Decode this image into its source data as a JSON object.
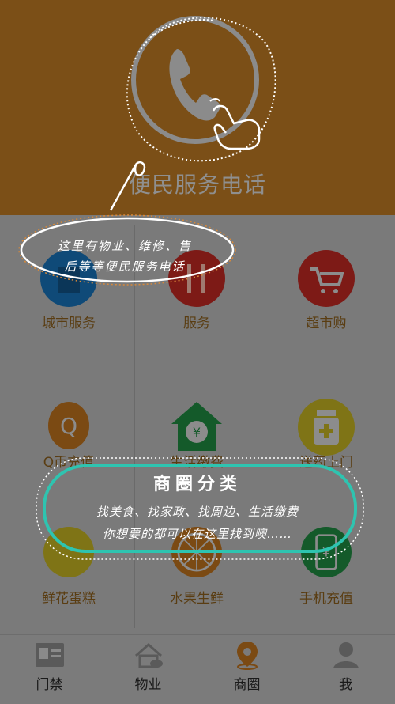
{
  "header": {
    "title": "便民服务电话"
  },
  "callout_top": {
    "line1": "这里有物业、维修、售",
    "line2": "后等等便民服务电话"
  },
  "grid": {
    "items": [
      {
        "label": "城市服务",
        "icon": "city-building-icon",
        "color": "#0f4a78"
      },
      {
        "label": "服务",
        "icon": "fork-knife-icon",
        "color": "#7d1a16"
      },
      {
        "label": "超市购",
        "icon": "shopping-cart-icon",
        "color": "#7d1a16"
      },
      {
        "label": "Q币充值",
        "icon": "qq-penguin-icon",
        "color": "#7b4a13"
      },
      {
        "label": "生活缴费",
        "icon": "house-yen-icon",
        "color": "#145a2a"
      },
      {
        "label": "送药上门",
        "icon": "medicine-bottle-icon",
        "color": "#7f7416"
      },
      {
        "label": "鲜花蛋糕",
        "icon": "cake-icon",
        "color": "#7f7416"
      },
      {
        "label": "水果生鲜",
        "icon": "orange-slice-icon",
        "color": "#7b4a13"
      },
      {
        "label": "手机充值",
        "icon": "phone-yen-icon",
        "color": "#145a2a"
      }
    ]
  },
  "callout_bottom": {
    "title": "商圈分类",
    "line1": "找美食、找家政、找周边、生活缴费",
    "line2": "你想要的都可以在这里找到噢……"
  },
  "nav": {
    "items": [
      {
        "label": "门禁",
        "icon": "id-card-icon"
      },
      {
        "label": "物业",
        "icon": "house-chat-icon"
      },
      {
        "label": "商圈",
        "icon": "location-pin-icon"
      },
      {
        "label": "我",
        "icon": "person-icon"
      }
    ],
    "active": "商圈"
  },
  "colors": {
    "header_bg": "#7b4f17",
    "overlay_gray": "#7a7a7a",
    "callout_ring": "#2ec4b0",
    "callout_dots": "#d98a3a"
  }
}
